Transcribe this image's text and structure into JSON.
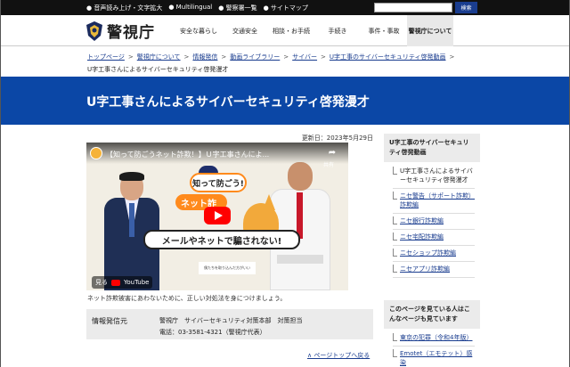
{
  "utility_bar": {
    "links": [
      "● 音声読み上げ・文字拡大",
      "● Multilingual",
      "● 警察署一覧",
      "● サイトマップ"
    ],
    "search_placeholder": "",
    "search_button": "検索"
  },
  "header": {
    "logo_text": "警視庁",
    "nav": [
      {
        "label": "安全な暮らし"
      },
      {
        "label": "交通安全"
      },
      {
        "label": "相談・お手続"
      },
      {
        "label": "手続き"
      },
      {
        "label": "事件・事故"
      },
      {
        "label": "警視庁について"
      }
    ]
  },
  "breadcrumb": {
    "items": [
      "トップページ",
      "警視庁について",
      "情報発信",
      "動画ライブラリー",
      "サイバー",
      "U字工事のサイバーセキュリティ啓発動画"
    ],
    "current": "U字工事さんによるサイバーセキュリティ啓発漫才"
  },
  "page": {
    "title": "U字工事さんによるサイバーセキュリティ啓発漫才",
    "updated": "更新日：2023年5月29日",
    "video": {
      "title": "【知って防ごうネット詐欺！】Ｕ字工事さんによ...",
      "share_icon": "share-icon",
      "share_label": "共有",
      "sign_top": "知って防ごう!",
      "sign_bottom": "ネット詐",
      "slogan": "メールやネットで騙されない!",
      "caption": "僕たちを取り込んだ方がいい",
      "watch_label": "見る",
      "youtube_label": "YouTube"
    },
    "video_note": "ネット詐欺被害にあわないために、正しい対処法を身につけましょう。",
    "info": {
      "label": "情報発信元",
      "dept": "警視庁　サイバーセキュリティ対策本部　対策担当",
      "tel": "電話：03-3581-4321（警視庁代表）"
    },
    "pagetop": "∧ ページトップへ戻る"
  },
  "sidebar": {
    "heading": "U字工事のサイバーセキュリティ啓発動画",
    "items": [
      {
        "label": "U字工事さんによるサイバーセキュリティ啓発漫才",
        "link": false
      },
      {
        "label": "ニセ警告（サポート詐欺）詐欺編",
        "link": true
      },
      {
        "label": "ニセ銀行詐欺編",
        "link": true
      },
      {
        "label": "ニセ宅配詐欺編",
        "link": true
      },
      {
        "label": "ニセショップ詐欺編",
        "link": true
      },
      {
        "label": "ニセアプリ詐欺編",
        "link": true
      }
    ],
    "heading2": "このページを見ている人はこんなページも見ています",
    "items2": [
      {
        "label": "東京の犯罪（令和4年版）",
        "link": true
      },
      {
        "label": "Emotet（エモテット）感染",
        "link": true
      }
    ]
  },
  "colors": {
    "banner": "#0b47a6",
    "link": "#1a3d8f",
    "topbar": "#111111"
  }
}
